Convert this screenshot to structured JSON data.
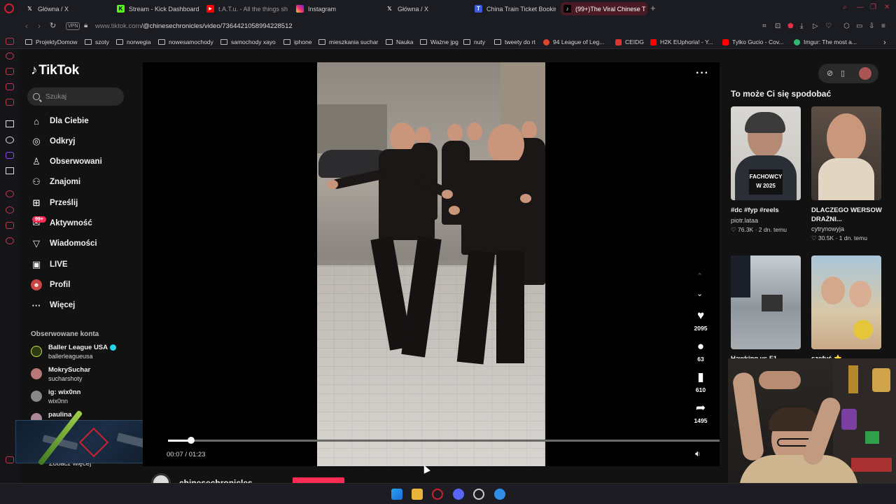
{
  "browser": {
    "tabs": [
      {
        "label": "Główna / X",
        "icon": "x-logo-icon"
      },
      {
        "label": "Stream - Kick Dashboard",
        "icon": "kick-icon"
      },
      {
        "label": "t.A.T.u. - All the things sh",
        "icon": "youtube-icon"
      },
      {
        "label": "Instagram",
        "icon": "instagram-icon"
      },
      {
        "label": "Główna / X",
        "icon": "x-logo-icon"
      },
      {
        "label": "China Train Ticket Bookin",
        "icon": "tab-t-icon"
      },
      {
        "label": "(99+)The Viral Chinese T",
        "icon": "tiktok-icon",
        "active": true
      }
    ],
    "vpn_label": "VPN",
    "url_prefix": "www.tiktok.com",
    "url_path": "/@chinesechronicles/video/7364421058994228512",
    "bookmarks": [
      "ProjektyDomow",
      "szoty",
      "norwegia",
      "nowesamochody",
      "samochody xayo",
      "iphone",
      "mieszkania suchar",
      "Nauka",
      "Ważne jpg",
      "nuty",
      "tweety do rt",
      "94 League of Leg...",
      "CEIDG",
      "H2K EUphoria! - Y...",
      "Tylko Gucio - Cov...",
      "Imgur: The most a..."
    ]
  },
  "tiktok": {
    "logo": "TikTok",
    "search_placeholder": "Szukaj",
    "nav": [
      {
        "label": "Dla Ciebie",
        "icon": "home-icon"
      },
      {
        "label": "Odkryj",
        "icon": "compass-icon"
      },
      {
        "label": "Obserwowani",
        "icon": "following-icon"
      },
      {
        "label": "Znajomi",
        "icon": "friends-icon"
      },
      {
        "label": "Prześlij",
        "icon": "upload-icon"
      },
      {
        "label": "Aktywność",
        "icon": "activity-icon"
      },
      {
        "label": "Wiadomości",
        "icon": "messages-icon"
      },
      {
        "label": "LIVE",
        "icon": "live-icon"
      },
      {
        "label": "Profil",
        "icon": "profile-icon"
      },
      {
        "label": "Więcej",
        "icon": "more-icon"
      }
    ],
    "activity_badge": "99+",
    "followed_title": "Obserwowane konta",
    "followed": [
      {
        "name": "Baller League USA",
        "handle": "ballerleagueusa",
        "verified": true
      },
      {
        "name": "MokrySuchar",
        "handle": "sucharshoty"
      },
      {
        "name": "ig: wix0nn",
        "handle": "wix0nn"
      },
      {
        "name": "paulina",
        "handle": ""
      }
    ],
    "see_more": "Zobacz więcej",
    "video": {
      "current_time": "00:07",
      "duration": "01:23",
      "time_display": "00:07 / 01:23",
      "progress": 0.084,
      "likes": "2095",
      "comments": "63",
      "saves": "610",
      "shares": "1495",
      "author": "chinesechronicles"
    },
    "recommend_title": "To może Ci się spodobać",
    "recommendations": [
      {
        "title": "#dc #fyp #reels",
        "user": "piotr.lataa",
        "likes": "76.3K",
        "age": "2 dn. temu",
        "overlay": "FACHOWCY W 2025"
      },
      {
        "title": "DLACZEGO WERSOW DRAŻNI...",
        "user": "cytrynowyja",
        "likes": "30.5K",
        "age": "1 dn. temu",
        "overlay": ""
      },
      {
        "title": "Hawking vs F1",
        "user": "",
        "likes": "",
        "age": "",
        "overlay": ""
      },
      {
        "title": "szefuś ⭐",
        "user": "",
        "likes": "",
        "age": "",
        "overlay": ""
      }
    ]
  },
  "colors": {
    "accent": "#fe2c55",
    "opera_red": "#c0394a",
    "active_tab": "#4a1a24"
  }
}
